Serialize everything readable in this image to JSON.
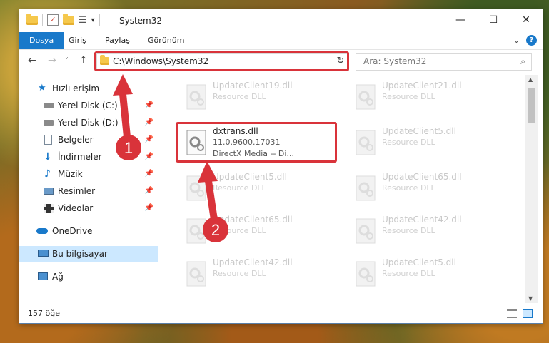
{
  "window": {
    "title": "System32",
    "minimize": "—",
    "maximize": "☐",
    "close": "✕"
  },
  "ribbon": {
    "tabs": [
      "Dosya",
      "Giriş",
      "Paylaş",
      "Görünüm"
    ],
    "help": "?"
  },
  "nav": {
    "back": "←",
    "forward": "→",
    "recent": "˅",
    "up": "↑",
    "address": "C:\\Windows\\System32",
    "refresh": "↻",
    "search_placeholder": "Ara: System32"
  },
  "sidebar": {
    "items": [
      {
        "label": "Hızlı erişim",
        "icon": "star-icon"
      },
      {
        "label": "Yerel Disk (C:)",
        "icon": "drive-icon",
        "pinned": true
      },
      {
        "label": "Yerel Disk (D:)",
        "icon": "drive-icon",
        "pinned": true
      },
      {
        "label": "Belgeler",
        "icon": "document-icon",
        "pinned": true
      },
      {
        "label": "İndirmeler",
        "icon": "download-icon",
        "pinned": true
      },
      {
        "label": "Müzik",
        "icon": "music-icon",
        "pinned": true
      },
      {
        "label": "Resimler",
        "icon": "picture-icon",
        "pinned": true
      },
      {
        "label": "Videolar",
        "icon": "video-icon",
        "pinned": true
      },
      {
        "label": "OneDrive",
        "icon": "cloud-icon"
      },
      {
        "label": "Bu bilgisayar",
        "icon": "computer-icon",
        "selected": true
      },
      {
        "label": "Ağ",
        "icon": "network-icon"
      }
    ]
  },
  "files": {
    "left_column": [
      {
        "name": "UpdateClient19.dll",
        "desc": "Resource DLL"
      },
      {
        "name": "dxtrans.dll",
        "version": "11.0.9600.17031",
        "desc": "DirectX Media -- Di...",
        "highlighted": true
      },
      {
        "name": "UpdateClient5.dll",
        "desc": "Resource DLL"
      },
      {
        "name": "UpdateClient65.dll",
        "desc": "Resource DLL"
      },
      {
        "name": "UpdateClient42.dll",
        "desc": "Resource DLL"
      }
    ],
    "right_column": [
      {
        "name": "UpdateClient21.dll",
        "desc": "Resource DLL"
      },
      {
        "name": "UpdateClient5.dll",
        "desc": "Resource DLL"
      },
      {
        "name": "UpdateClient65.dll",
        "desc": "Resource DLL"
      },
      {
        "name": "UpdateClient42.dll",
        "desc": "Resource DLL"
      },
      {
        "name": "UpdateClient5.dll",
        "desc": "Resource DLL"
      }
    ]
  },
  "status": {
    "count": "157 öğe"
  },
  "annotations": {
    "step1": "1",
    "step2": "2",
    "color": "#d9333a"
  },
  "colors": {
    "accent": "#1979ca",
    "selection": "#cce8ff"
  }
}
